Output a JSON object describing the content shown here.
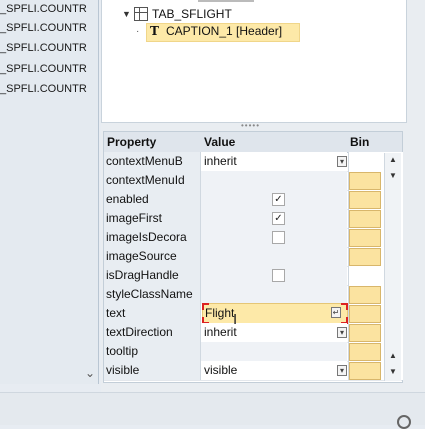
{
  "left_panel": {
    "rows": [
      "_SPFLI.COUNTR",
      "_SPFLI.COUNTR",
      "_SPFLI.COUNTR",
      "_SPFLI.COUNTR",
      "_SPFLI.COUNTR"
    ]
  },
  "tree": {
    "tab_node": "TAB_SFLIGHT",
    "caption_node": "CAPTION_1  [Header]"
  },
  "grid": {
    "headers": {
      "property": "Property",
      "value": "Value",
      "binding": "Bin"
    },
    "rows": [
      {
        "name": "contextMenuB",
        "value": "inherit",
        "kind": "text",
        "ro": false,
        "bind_btn": false,
        "mini": true
      },
      {
        "name": "contextMenuId",
        "value": "",
        "kind": "text",
        "ro": true,
        "bind_btn": true,
        "mini": false
      },
      {
        "name": "enabled",
        "value": "",
        "kind": "checkbox",
        "checked": true,
        "ro": true,
        "bind_btn": true
      },
      {
        "name": "imageFirst",
        "value": "",
        "kind": "checkbox",
        "checked": true,
        "ro": true,
        "bind_btn": true
      },
      {
        "name": "imageIsDecora",
        "value": "",
        "kind": "checkbox",
        "checked": false,
        "ro": true,
        "bind_btn": true
      },
      {
        "name": "imageSource",
        "value": "",
        "kind": "text",
        "ro": true,
        "bind_btn": true
      },
      {
        "name": "isDragHandle",
        "value": "",
        "kind": "checkbox",
        "checked": false,
        "ro": true,
        "bind_btn": false
      },
      {
        "name": "styleClassName",
        "value": "",
        "kind": "text",
        "ro": true,
        "bind_btn": true
      },
      {
        "name": "text",
        "value": "Flight",
        "kind": "edit",
        "ro": false,
        "bind_btn": true
      },
      {
        "name": "textDirection",
        "value": "inherit",
        "kind": "text",
        "ro": false,
        "bind_btn": true,
        "mini": true
      },
      {
        "name": "tooltip",
        "value": "",
        "kind": "text",
        "ro": true,
        "bind_btn": true
      },
      {
        "name": "visible",
        "value": "visible",
        "kind": "text",
        "ro": false,
        "bind_btn": true,
        "mini": true
      }
    ]
  },
  "icons": {
    "scroll_up": "▲",
    "scroll_down": "▼",
    "check": "✓",
    "dropdown": "▾"
  }
}
